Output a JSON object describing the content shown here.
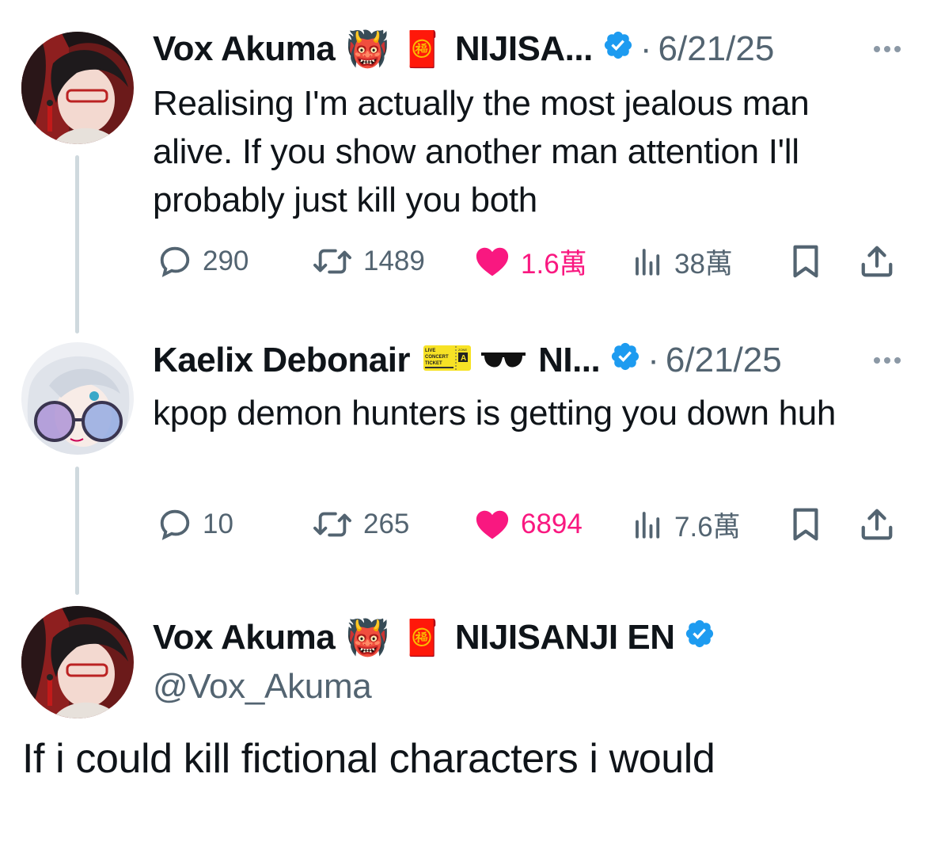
{
  "tweets": [
    {
      "name": "Vox Akuma",
      "emoji1": "👹",
      "emoji2": "🧧",
      "affiliation": "NIJISA...",
      "dot": "·",
      "date": "6/21/25",
      "text": "Realising I'm actually the most jealous man alive. If you show another man attention I'll probably just kill you both",
      "replies": "290",
      "retweets": "1489",
      "likes": "1.6萬",
      "views": "38萬"
    },
    {
      "name": "Kaelix Debonair",
      "emoji1": "🎫",
      "emoji2": "🕶️",
      "affiliation": "NI...",
      "dot": "·",
      "date": "6/21/25",
      "text": "kpop demon hunters is getting you down huh",
      "replies": "10",
      "retweets": "265",
      "likes": "6894",
      "views": "7.6萬"
    }
  ],
  "main": {
    "name": "Vox Akuma",
    "emoji1": "👹",
    "emoji2": "🧧",
    "affiliation": "NIJISANJI EN",
    "handle": "@Vox_Akuma",
    "text": "If i could kill fictional characters i would"
  },
  "ticket_emoji_text": {
    "line1": "LIVE",
    "line2": "CONCERT",
    "line3": "TICKET",
    "zone": "ZONE",
    "zone_letter": "A"
  },
  "colors": {
    "verified": "#1d9bf0",
    "like": "#f91880",
    "muted": "#536471",
    "thread_line": "#cfd9de"
  },
  "icons": [
    "reply-icon",
    "retweet-icon",
    "heart-icon",
    "views-icon",
    "bookmark-icon",
    "share-icon",
    "verified-icon",
    "more-icon"
  ]
}
